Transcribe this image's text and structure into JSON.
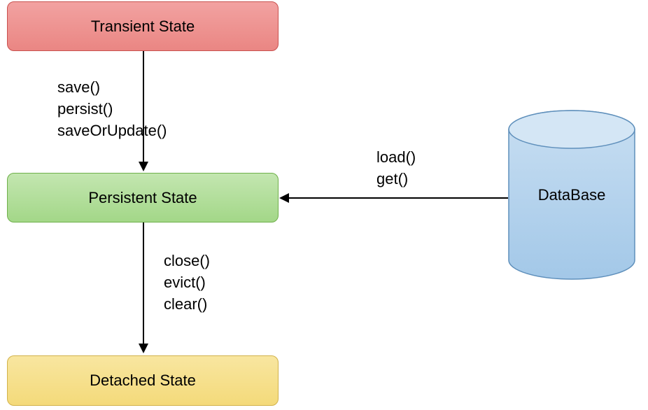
{
  "states": {
    "transient": "Transient State",
    "persistent": "Persistent State",
    "detached": "Detached State"
  },
  "database": "DataBase",
  "transitions": {
    "transient_to_persistent": {
      "lines": [
        "save()",
        "persist()",
        "saveOrUpdate()"
      ]
    },
    "persistent_to_detached": {
      "lines": [
        "close()",
        "evict()",
        "clear()"
      ]
    },
    "database_to_persistent": {
      "lines": [
        "load()",
        "get()"
      ]
    }
  },
  "colors": {
    "transient_fill": "#ea8683",
    "persistent_fill": "#a3d788",
    "detached_fill": "#f4da7a",
    "database_fill": "#a9cbeb"
  }
}
